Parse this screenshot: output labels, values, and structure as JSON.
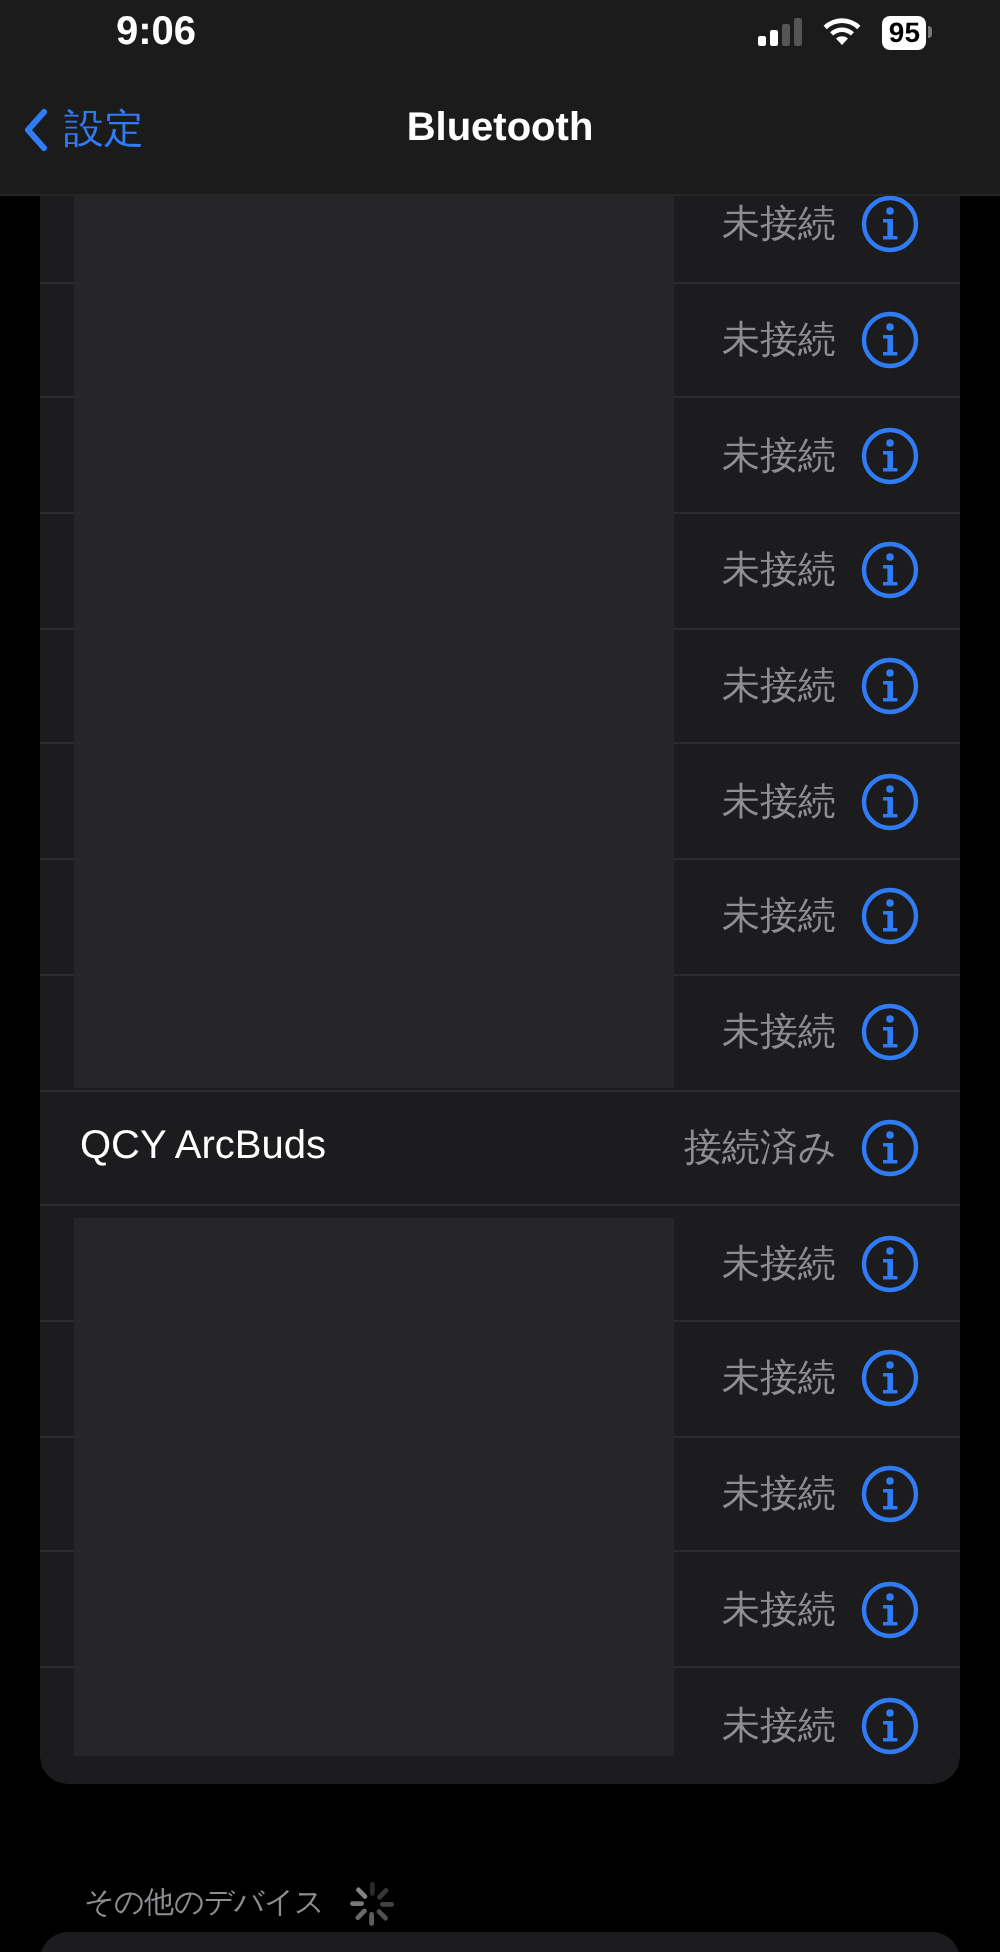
{
  "status_bar": {
    "time": "9:06",
    "battery": "95"
  },
  "nav": {
    "back": "設定",
    "title": "Bluetooth"
  },
  "devices": [
    {
      "redacted": true,
      "status": "未接続"
    },
    {
      "redacted": true,
      "status": "未接続"
    },
    {
      "redacted": true,
      "status": "未接続"
    },
    {
      "redacted": true,
      "status": "未接続"
    },
    {
      "redacted": true,
      "status": "未接続"
    },
    {
      "redacted": true,
      "status": "未接続"
    },
    {
      "redacted": true,
      "status": "未接続"
    },
    {
      "redacted": true,
      "status": "未接続"
    },
    {
      "redacted": false,
      "name": "QCY ArcBuds",
      "status": "接続済み"
    },
    {
      "redacted": true,
      "status": "未接続"
    },
    {
      "redacted": true,
      "status": "未接続"
    },
    {
      "redacted": true,
      "status": "未接続"
    },
    {
      "redacted": true,
      "status": "未接続"
    },
    {
      "redacted": true,
      "status": "未接続"
    }
  ],
  "other_devices": {
    "header": "その他のデバイス",
    "searching": true
  }
}
